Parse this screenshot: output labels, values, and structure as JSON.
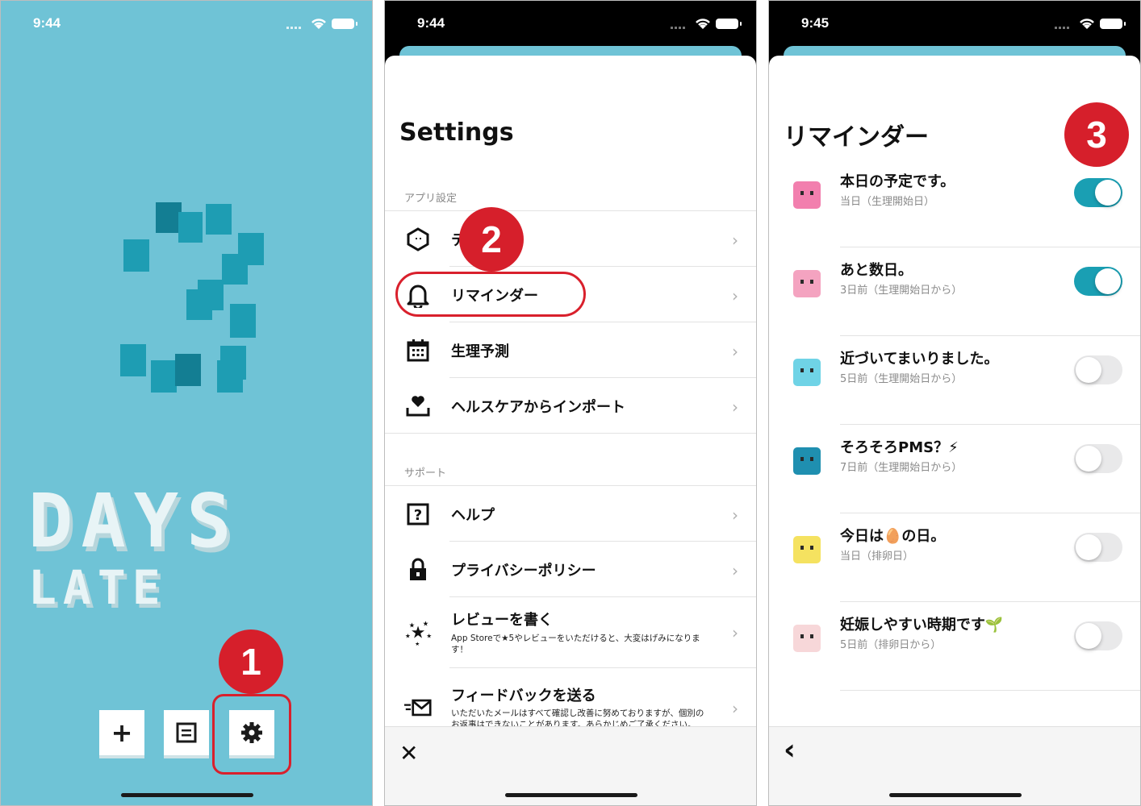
{
  "screen1": {
    "time": "9:44",
    "logo_line1": "DAYS",
    "logo_line2": "LATE",
    "add_label": "+",
    "badge": "1"
  },
  "screen2": {
    "time": "9:44",
    "title": "Settings",
    "badge": "2",
    "section_app": "アプリ設定",
    "app_items": [
      {
        "label": "テ",
        "icon": "hexagon-icon"
      },
      {
        "label": "リマインダー",
        "icon": "bell-icon"
      },
      {
        "label": "生理予測",
        "icon": "calendar-icon"
      },
      {
        "label": "ヘルスケアからインポート",
        "icon": "import-heart-icon"
      }
    ],
    "section_support": "サポート",
    "support_items": [
      {
        "label": "ヘルプ",
        "icon": "help-icon"
      },
      {
        "label": "プライバシーポリシー",
        "icon": "lock-icon"
      },
      {
        "label": "レビューを書く",
        "sub": "App Storeで★5やレビューをいただけると、大変はげみになります！",
        "icon": "stars-icon"
      },
      {
        "label": "フィードバックを送る",
        "sub": "いただいたメールはすべて確認し改善に努めておりますが、個別のお返事はできないことがあります。あらかじめご了承ください。",
        "icon": "mail-icon"
      }
    ],
    "close": "✕"
  },
  "screen3": {
    "time": "9:45",
    "title": "リマインダー",
    "badge": "3",
    "back": "‹",
    "reminders": [
      {
        "label": "本日の予定です。",
        "sub": "当日（生理開始日）",
        "on": true,
        "color": "#f27fae"
      },
      {
        "label": "あと数日。",
        "sub": "3日前（生理開始日から）",
        "on": true,
        "color": "#f4a3c0"
      },
      {
        "label": "近づいてまいりました。",
        "sub": "5日前（生理開始日から）",
        "on": false,
        "color": "#6fd3e6"
      },
      {
        "label": "そろそろPMS？⚡",
        "sub": "7日前（生理開始日から）",
        "on": false,
        "color": "#1f8fb0"
      },
      {
        "label": "今日は🥚の日。",
        "sub": "当日（排卵日）",
        "on": false,
        "color": "#f5e260"
      },
      {
        "label": "妊娠しやすい時期です🌱",
        "sub": "5日前（排卵日から）",
        "on": false,
        "color": "#f7d7d9"
      }
    ]
  },
  "colors": {
    "accent": "#1a9fb3",
    "badge_red": "#d61f2b",
    "bg_teal": "#6fc3d6"
  }
}
